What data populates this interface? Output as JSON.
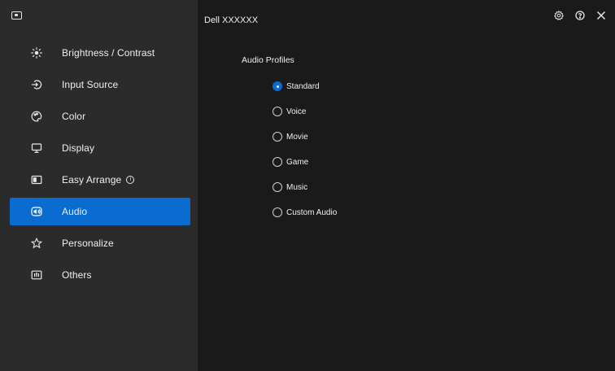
{
  "window": {
    "title": "Dell XXXXXX"
  },
  "sidebar": {
    "items": [
      {
        "label": "Brightness / Contrast",
        "icon": "sun-icon"
      },
      {
        "label": "Input Source",
        "icon": "input-source-icon"
      },
      {
        "label": "Color",
        "icon": "color-palette-icon"
      },
      {
        "label": "Display",
        "icon": "display-monitor-icon"
      },
      {
        "label": "Easy Arrange",
        "icon": "easy-arrange-icon",
        "info_glyph": "i"
      },
      {
        "label": "Audio",
        "icon": "speaker-icon",
        "active": true
      },
      {
        "label": "Personalize",
        "icon": "star-icon"
      },
      {
        "label": "Others",
        "icon": "others-icon"
      }
    ]
  },
  "audio": {
    "section_label": "Audio Profiles",
    "options": [
      "Standard",
      "Voice",
      "Movie",
      "Game",
      "Music",
      "Custom Audio"
    ],
    "selected": "Standard"
  },
  "colors": {
    "accent": "#0a6bd1",
    "sidebar_bg": "#2b2b2b",
    "main_bg": "#1a1a1a"
  }
}
